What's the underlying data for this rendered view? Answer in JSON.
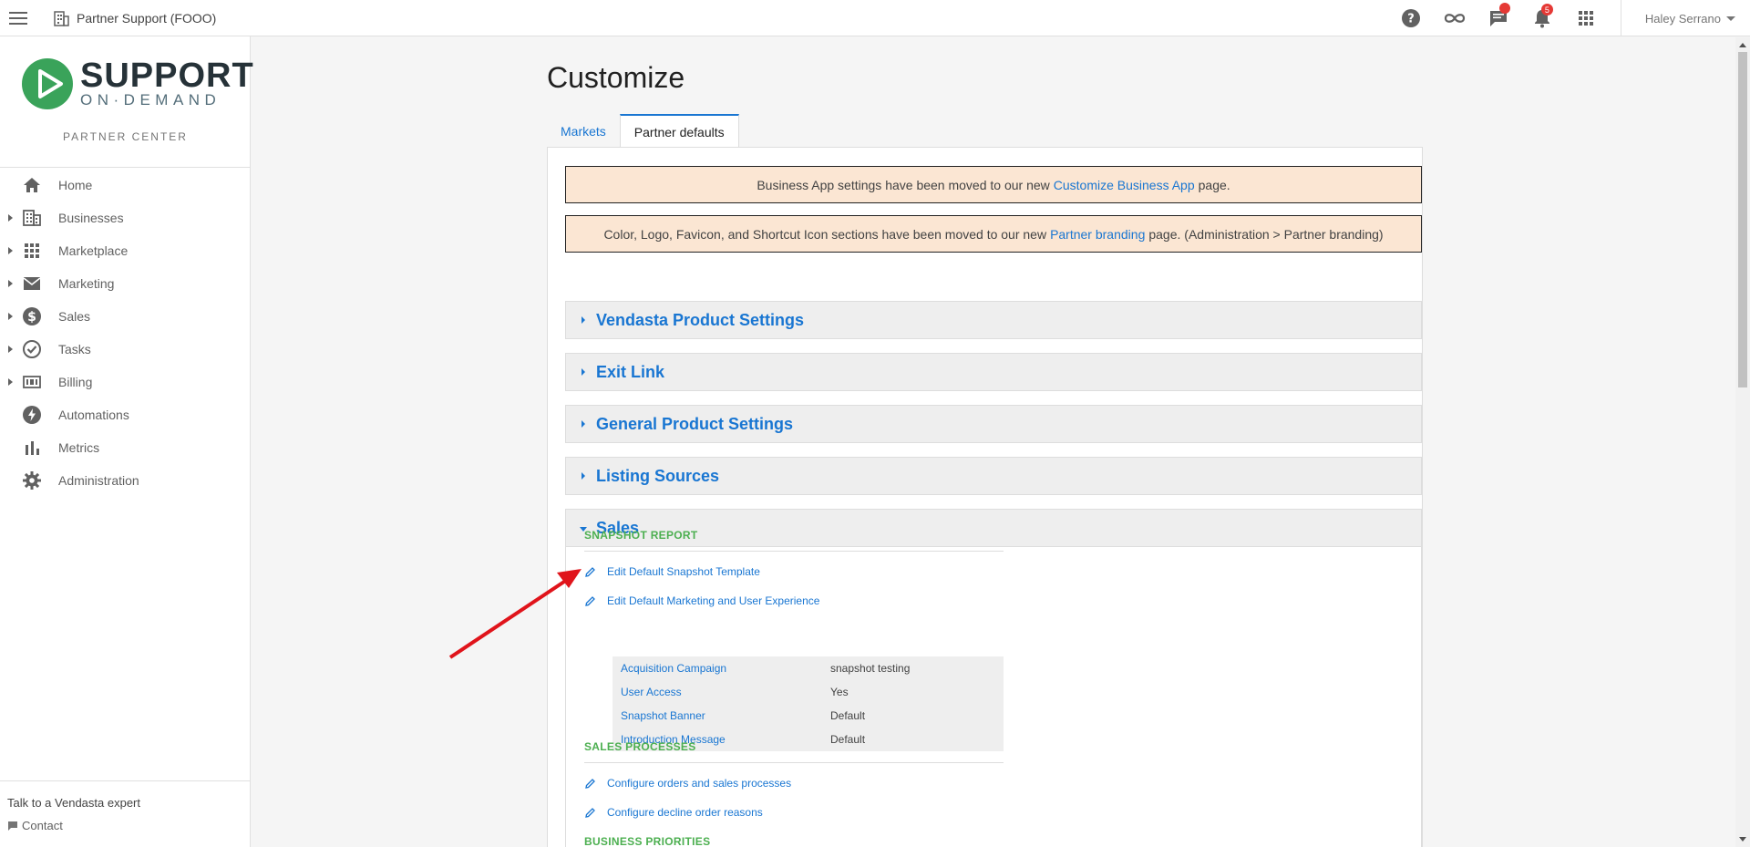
{
  "topbar": {
    "org_name": "Partner Support (FOOO)",
    "notification_count": "5",
    "user_name": "Haley Serrano"
  },
  "sidebar": {
    "logo_title": "SUPPORT",
    "logo_sub": "ON·DEMAND",
    "logo_center": "PARTNER CENTER",
    "items": [
      {
        "label": "Home",
        "icon": "home-icon",
        "expandable": false
      },
      {
        "label": "Businesses",
        "icon": "building-icon",
        "expandable": true
      },
      {
        "label": "Marketplace",
        "icon": "grid-icon",
        "expandable": true
      },
      {
        "label": "Marketing",
        "icon": "mail-icon",
        "expandable": true
      },
      {
        "label": "Sales",
        "icon": "dollar-icon",
        "expandable": true
      },
      {
        "label": "Tasks",
        "icon": "check-circle-icon",
        "expandable": true
      },
      {
        "label": "Billing",
        "icon": "billing-icon",
        "expandable": true
      },
      {
        "label": "Automations",
        "icon": "bolt-icon",
        "expandable": false
      },
      {
        "label": "Metrics",
        "icon": "bar-chart-icon",
        "expandable": false
      },
      {
        "label": "Administration",
        "icon": "gear-icon",
        "expandable": false
      }
    ],
    "footer_title": "Talk to a Vendasta expert",
    "footer_contact": "Contact"
  },
  "main": {
    "page_title": "Customize",
    "tabs": [
      {
        "label": "Markets",
        "active": false
      },
      {
        "label": "Partner defaults",
        "active": true
      }
    ],
    "notice1": {
      "before": "Business App settings have been moved to our new",
      "link": "Customize Business App",
      "after": "page."
    },
    "notice2": {
      "before": "Color, Logo, Favicon, and Shortcut Icon sections have been moved to our new",
      "link": "Partner branding",
      "after": "page. (Administration > Partner branding)"
    },
    "accordions": [
      {
        "label": "Vendasta Product Settings",
        "expanded": false
      },
      {
        "label": "Exit Link",
        "expanded": false
      },
      {
        "label": "General Product Settings",
        "expanded": false
      },
      {
        "label": "Listing Sources",
        "expanded": false
      },
      {
        "label": "Sales",
        "expanded": true
      }
    ],
    "sales": {
      "snapshot_heading": "SNAPSHOT REPORT",
      "edit_template": "Edit Default Snapshot Template",
      "edit_marketing": "Edit Default Marketing and User Experience",
      "details": [
        {
          "key": "Acquisition Campaign",
          "value": "snapshot testing"
        },
        {
          "key": "User Access",
          "value": "Yes"
        },
        {
          "key": "Snapshot Banner",
          "value": "Default"
        },
        {
          "key": "Introduction Message",
          "value": "Default"
        }
      ],
      "processes_heading": "SALES PROCESSES",
      "configure_orders": "Configure orders and sales processes",
      "configure_decline": "Configure decline order reasons",
      "priorities_heading": "BUSINESS PRIORITIES"
    }
  },
  "colors": {
    "accent": "#1976d2",
    "section_heading": "#4caf50",
    "notice_bg": "#fbe6d3",
    "annotation_arrow": "#e0141b"
  }
}
